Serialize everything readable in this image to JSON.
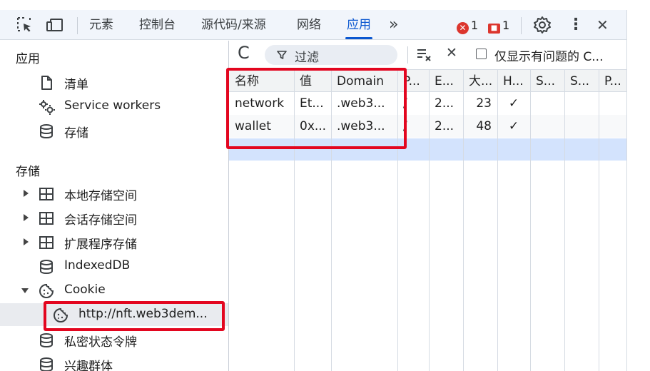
{
  "topbar": {
    "tabs": [
      "元素",
      "控制台",
      "源代码/来源",
      "网络",
      "应用"
    ],
    "more": "»",
    "errors_count": "1",
    "issues_count": "1",
    "error_symbol": "✕",
    "issue_symbol": "■",
    "menu_icon": "⋮",
    "close_icon": "✕"
  },
  "sidebar": {
    "app_title": "应用",
    "app_items": [
      "清单",
      "Service workers",
      "存储"
    ],
    "storage_title": "存储",
    "storage_items": [
      "本地存储空间",
      "会话存储空间",
      "扩展程序存储",
      "IndexedDB",
      "Cookie"
    ],
    "cookie_child": "http://nft.web3dem...",
    "after_items": [
      "私密状态令牌",
      "兴趣群体"
    ]
  },
  "toolbar": {
    "refresh_icon": "C",
    "filter_placeholder": "过滤",
    "clear_icon": "✕",
    "only_issues_label": "仅显示有问题的 C..."
  },
  "table": {
    "headers": [
      "名称",
      "值",
      "Domain",
      "P...",
      "E...",
      "大...",
      "H...",
      "S...",
      "S...",
      "P..."
    ],
    "rows": [
      [
        "network",
        "Et...",
        ".web3...",
        "/",
        "2...",
        "23",
        "✓",
        "",
        "",
        ""
      ],
      [
        "wallet",
        "0x...",
        ".web3...",
        "/",
        "2...",
        "48",
        "✓",
        "",
        "",
        ""
      ]
    ]
  },
  "colors": {
    "accent": "#0b57d0",
    "highlight_box": "#e3061f",
    "selected_row": "#d3e3fd",
    "error": "#dc362e"
  }
}
